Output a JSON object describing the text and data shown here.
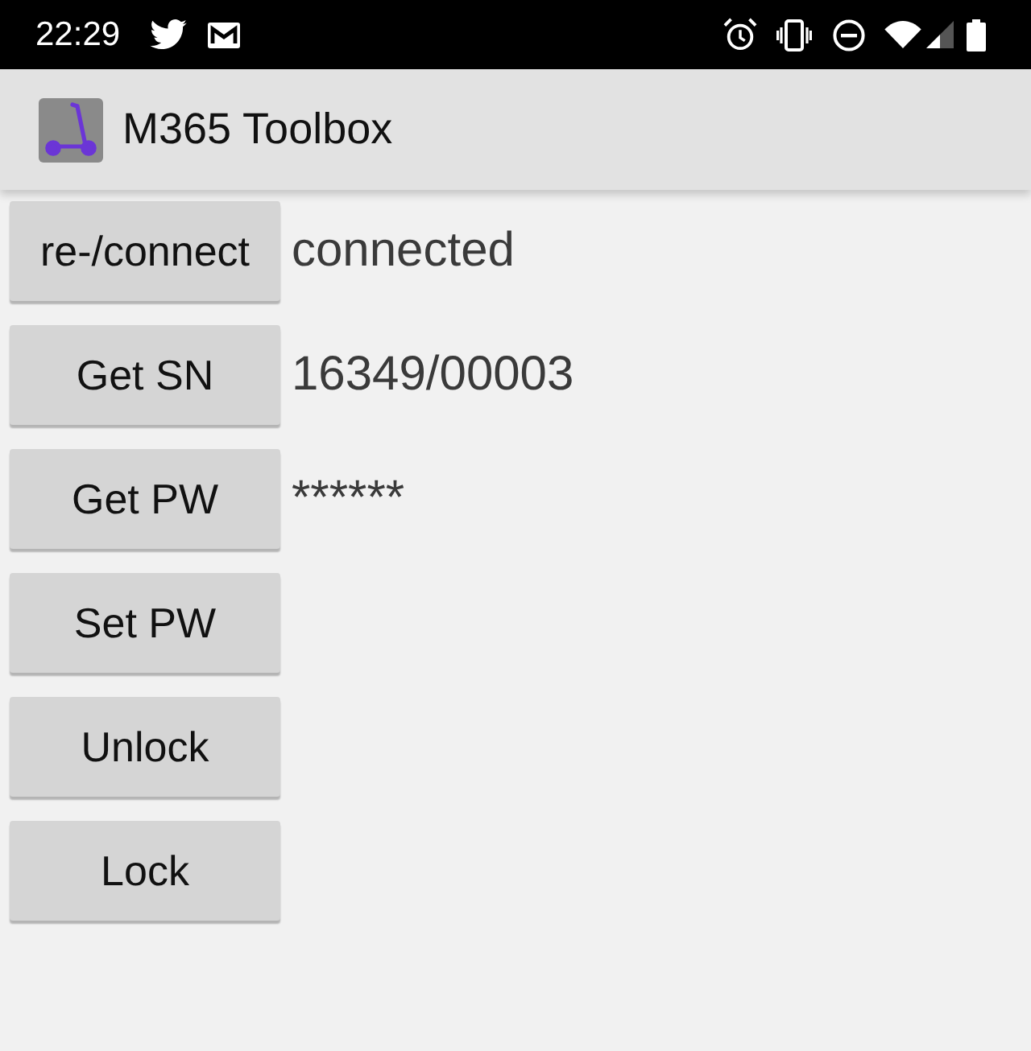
{
  "status_bar": {
    "time": "22:29"
  },
  "app_bar": {
    "title": "M365 Toolbox"
  },
  "rows": [
    {
      "button": "re-/connect",
      "value": "connected"
    },
    {
      "button": "Get SN",
      "value": "16349/00003"
    },
    {
      "button": "Get PW",
      "value": "******"
    },
    {
      "button": "Set PW"
    },
    {
      "button": "Unlock"
    },
    {
      "button": "Lock"
    }
  ]
}
